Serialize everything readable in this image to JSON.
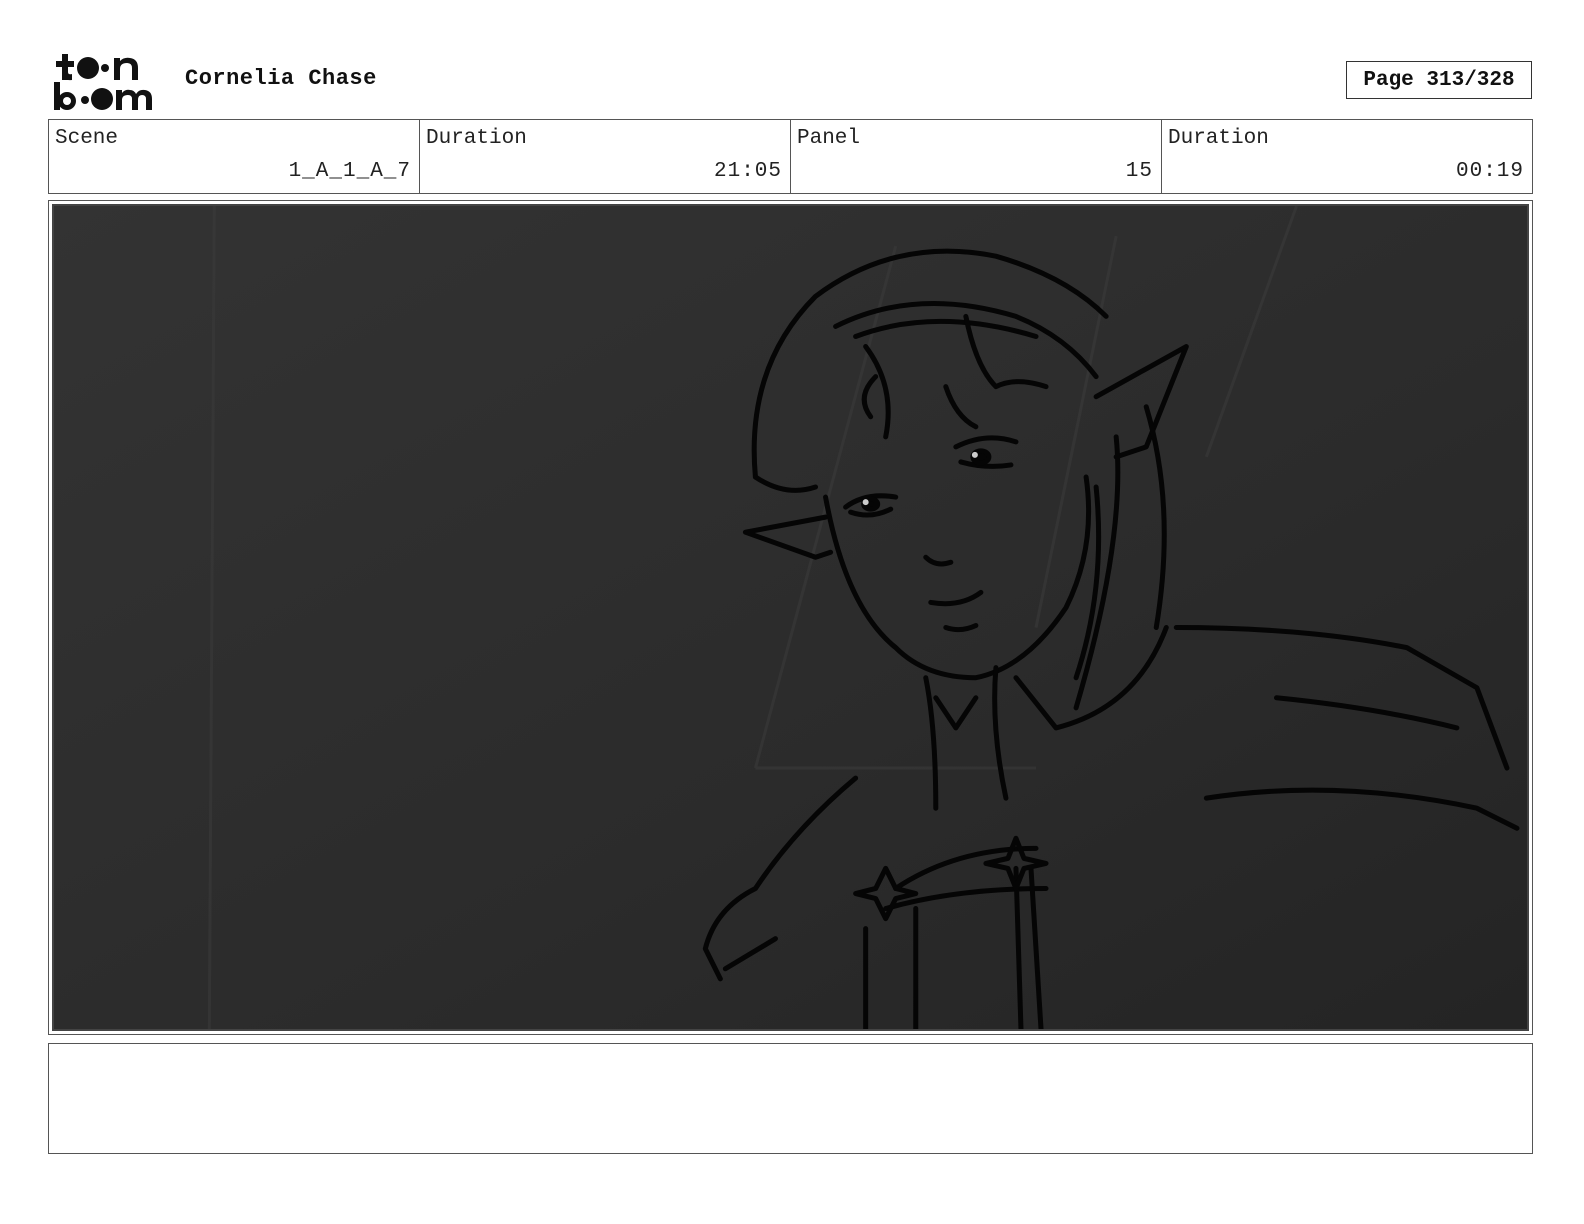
{
  "header": {
    "logo_text": "toonboom",
    "project_title": "Cornelia Chase",
    "page_label": "Page 313/328"
  },
  "info": {
    "scene_label": "Scene",
    "scene_value": "1_A_1_A_7",
    "scene_duration_label": "Duration",
    "scene_duration_value": "21:05",
    "panel_label": "Panel",
    "panel_value": "15",
    "panel_duration_label": "Duration",
    "panel_duration_value": "00:19"
  },
  "notes": {
    "text": ""
  }
}
